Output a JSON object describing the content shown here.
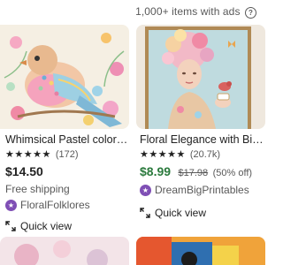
{
  "results": {
    "count_text": "1,000+ items with ads",
    "help_icon": "question-circle-icon"
  },
  "listings": [
    {
      "title": "Whimsical Pastel colored ...",
      "stars": "★★★★★",
      "reviews": "(172)",
      "price": "$14.50",
      "shipping": "Free shipping",
      "shop": "FloralFolklores",
      "shop_icon": "star-seller-icon",
      "quick_view": "Quick view",
      "favorite_icon": "heart-icon"
    },
    {
      "title": "Floral Elegance with Bird ...",
      "stars": "★★★★★",
      "reviews": "(20.7k)",
      "price": "$8.99",
      "original_price": "$17.98",
      "discount": "(50% off)",
      "shop": "DreamBigPrintables",
      "shop_icon": "star-seller-icon",
      "quick_view": "Quick view",
      "favorite_icon": "heart-icon"
    }
  ],
  "colors": {
    "sale_price": "#2b7a3d",
    "star_seller": "#7f4fb5",
    "muted_text": "#595959"
  }
}
